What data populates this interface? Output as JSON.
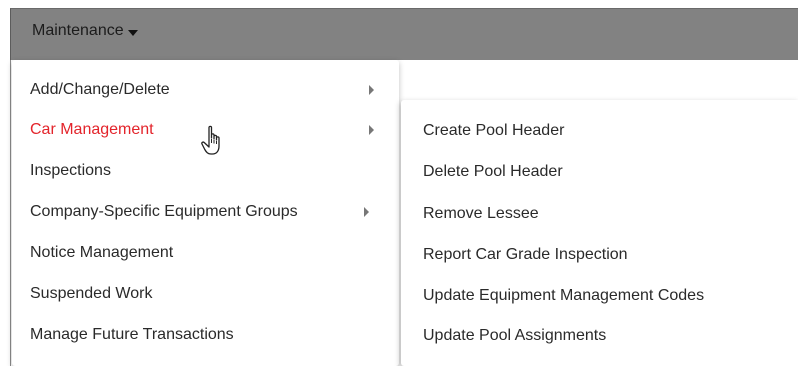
{
  "navbar": {
    "menu_label": "Maintenance",
    "caret_icon": "caret-down-icon"
  },
  "menu": {
    "items": [
      {
        "label": "Add/Change/Delete",
        "has_submenu": true
      },
      {
        "label": "Car Management",
        "has_submenu": true,
        "active": true
      },
      {
        "label": "Inspections"
      },
      {
        "label": "Company-Specific Equipment Groups",
        "has_submenu": true
      },
      {
        "label": "Notice Management"
      },
      {
        "label": "Suspended Work"
      },
      {
        "label": "Manage Future Transactions"
      }
    ]
  },
  "submenu": {
    "items": [
      {
        "label": "Create Pool Header"
      },
      {
        "label": "Delete Pool Header"
      },
      {
        "label": "Remove Lessee"
      },
      {
        "label": "Report Car Grade Inspection"
      },
      {
        "label": "Update Equipment Management Codes"
      },
      {
        "label": "Update Pool Assignments"
      }
    ]
  },
  "colors": {
    "navbar_bg": "#828282",
    "active_text": "#e3242b",
    "menu_text": "#2a2a2a"
  },
  "cursor_icon": "hand-pointer-icon"
}
